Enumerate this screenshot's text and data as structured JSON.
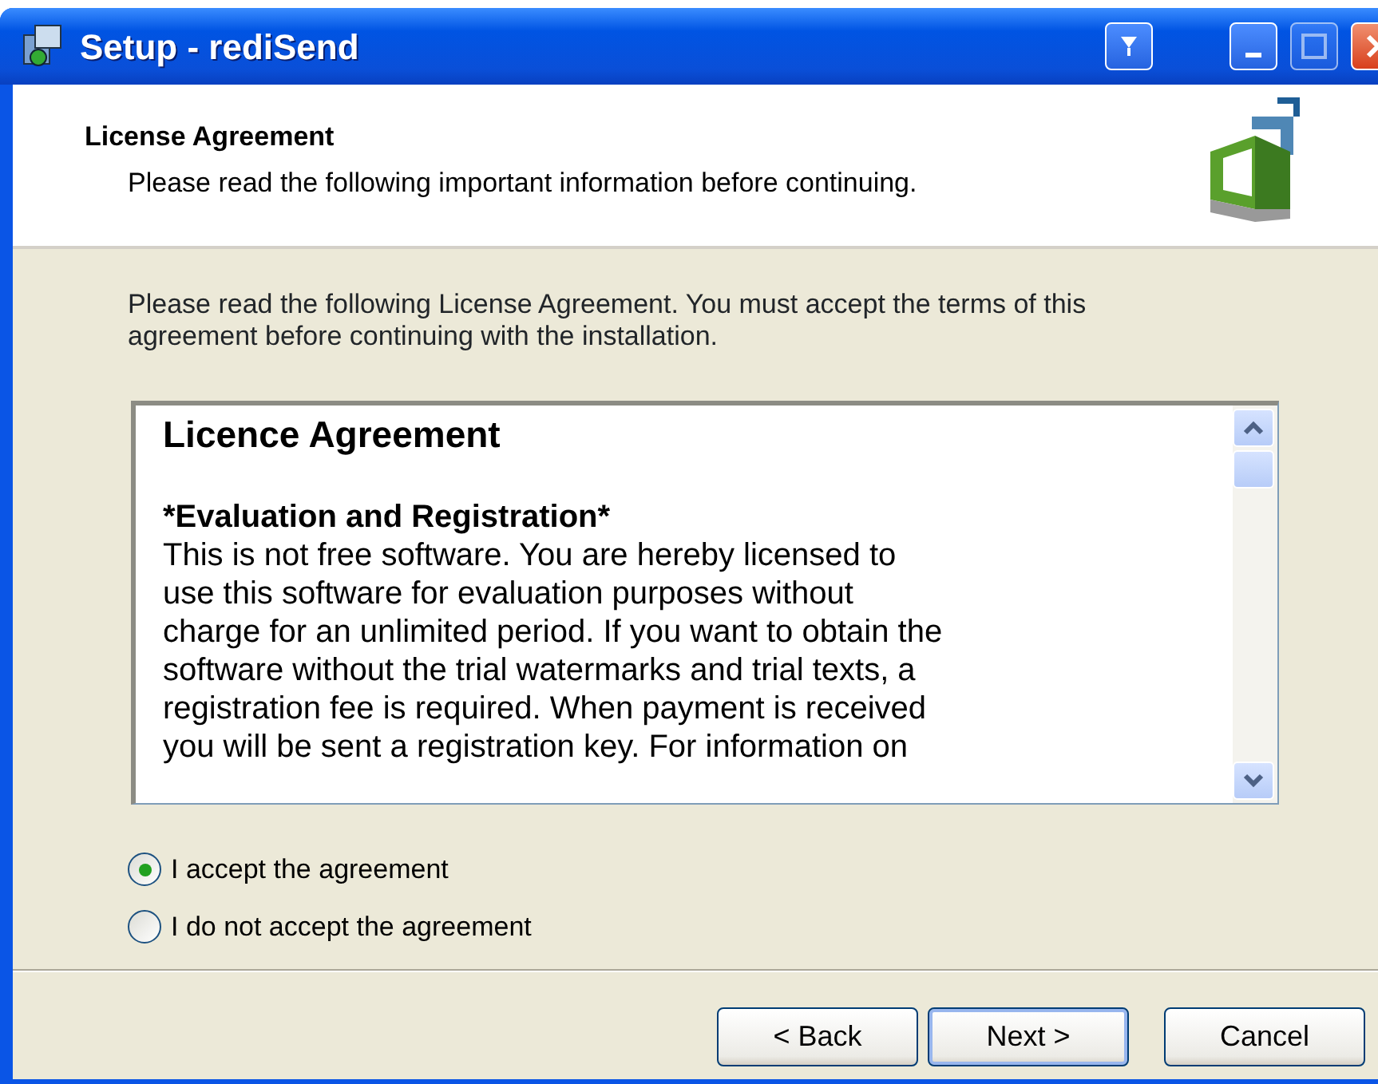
{
  "window": {
    "title": "Setup - rediSend"
  },
  "header": {
    "title": "License Agreement",
    "subtitle": "Please read the following important information before continuing."
  },
  "intro": "Please read the following License Agreement. You must accept the terms of this agreement before continuing with the installation.",
  "license": {
    "heading": "Licence Agreement",
    "section": "*Evaluation and Registration*",
    "lines": [
      "This is not free software. You are hereby licensed to",
      "use this software for evaluation purposes without",
      "charge for an unlimited period. If you want to obtain the",
      "software without the trial watermarks and trial texts, a",
      "registration fee is required. When payment is received",
      "you will be sent a registration key. For information on"
    ]
  },
  "options": [
    {
      "label": "I accept the agreement",
      "selected": true
    },
    {
      "label": "I do not accept the agreement",
      "selected": false
    }
  ],
  "buttons": [
    {
      "label": "< Back",
      "default": false
    },
    {
      "label": "Next >",
      "default": true
    },
    {
      "label": "Cancel",
      "default": false
    }
  ]
}
